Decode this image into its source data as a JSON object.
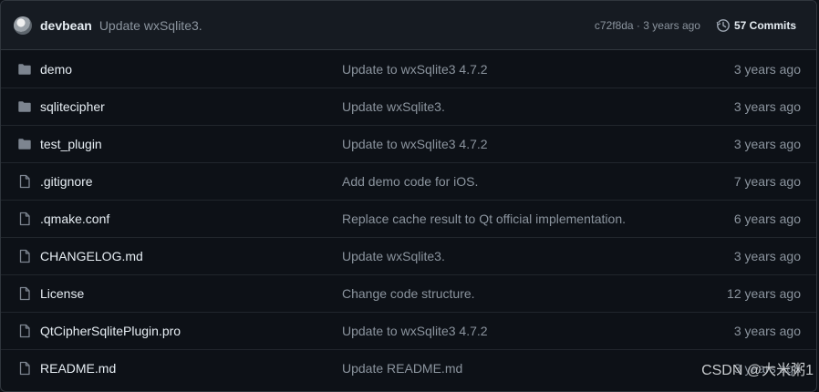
{
  "commit": {
    "avatar_icon": "user-avatar",
    "author": "devbean",
    "message": "Update wxSqlite3.",
    "meta": "c72f8da · 3 years ago",
    "commits_label": "57 Commits",
    "history_icon": "history-icon"
  },
  "files": [
    {
      "type": "folder",
      "name": "demo",
      "message": "Update to wxSqlite3 4.7.2",
      "age": "3 years ago"
    },
    {
      "type": "folder",
      "name": "sqlitecipher",
      "message": "Update wxSqlite3.",
      "age": "3 years ago"
    },
    {
      "type": "folder",
      "name": "test_plugin",
      "message": "Update to wxSqlite3 4.7.2",
      "age": "3 years ago"
    },
    {
      "type": "file",
      "name": ".gitignore",
      "message": "Add demo code for iOS.",
      "age": "7 years ago"
    },
    {
      "type": "file",
      "name": ".qmake.conf",
      "message": "Replace cache result to Qt official implementation.",
      "age": "6 years ago"
    },
    {
      "type": "file",
      "name": "CHANGELOG.md",
      "message": "Update wxSqlite3.",
      "age": "3 years ago"
    },
    {
      "type": "file",
      "name": "License",
      "message": "Change code structure.",
      "age": "12 years ago"
    },
    {
      "type": "file",
      "name": "QtCipherSqlitePlugin.pro",
      "message": "Update to wxSqlite3 4.7.2",
      "age": "3 years ago"
    },
    {
      "type": "file",
      "name": "README.md",
      "message": "Update README.md",
      "age": "3 years ago"
    }
  ],
  "watermark": "CSDN @大米粥1",
  "colors": {
    "background": "#0d1117",
    "header_background": "#161b22",
    "border": "#30363d",
    "text_primary": "#e6edf3",
    "text_muted": "#8b949e",
    "icon": "#7d8590"
  }
}
